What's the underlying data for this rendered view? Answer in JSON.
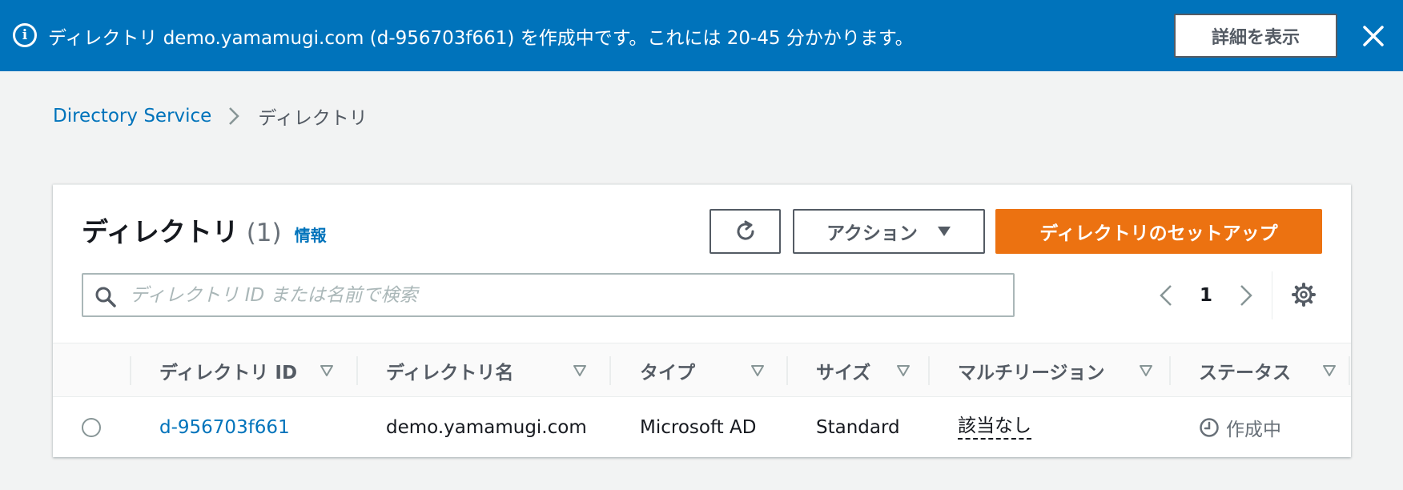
{
  "flash": {
    "message": "ディレクトリ demo.yamamugi.com (d-956703f661) を作成中です。これには 20-45 分かかります。",
    "details_button": "詳細を表示",
    "info_icon": "i",
    "color": "#0073bb"
  },
  "breadcrumb": {
    "service": "Directory Service",
    "current": "ディレクトリ"
  },
  "panel": {
    "title": "ディレクトリ",
    "count": "(1)",
    "info_link": "情報",
    "actions_label": "アクション",
    "primary_label": "ディレクトリのセットアップ",
    "primary_color": "#ec7211"
  },
  "search": {
    "placeholder": "ディレクトリ ID または名前で検索"
  },
  "pagination": {
    "current_page": "1"
  },
  "table": {
    "columns": [
      "ディレクトリ ID",
      "ディレクトリ名",
      "タイプ",
      "サイズ",
      "マルチリージョン",
      "ステータス"
    ],
    "rows": [
      {
        "id": "d-956703f661",
        "name": "demo.yamamugi.com",
        "type": "Microsoft AD",
        "size": "Standard",
        "multi_region": "該当なし",
        "status": "作成中"
      }
    ]
  }
}
